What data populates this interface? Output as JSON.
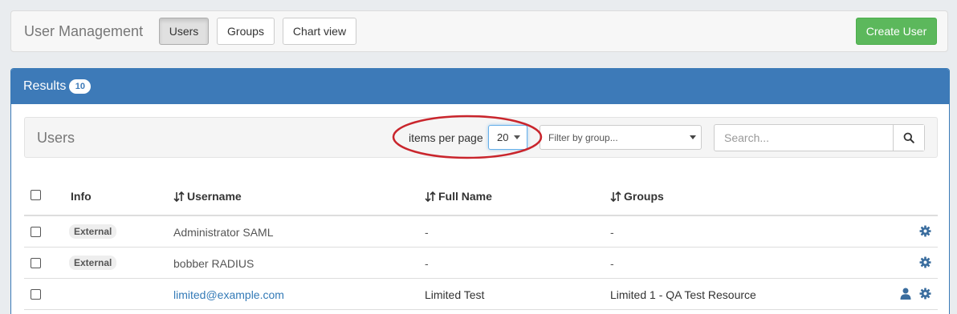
{
  "header": {
    "title": "User Management",
    "tabs": [
      {
        "label": "Users",
        "active": true
      },
      {
        "label": "Groups",
        "active": false
      },
      {
        "label": "Chart view",
        "active": false
      }
    ],
    "create_label": "Create User"
  },
  "results": {
    "title": "Results",
    "count": "10"
  },
  "toolbar": {
    "title": "Users",
    "items_per_page_label": "items per page",
    "items_per_page_value": "20",
    "group_filter_placeholder": "Filter by group...",
    "search_placeholder": "Search..."
  },
  "table": {
    "columns": [
      "Info",
      "Username",
      "Full Name",
      "Groups"
    ],
    "rows": [
      {
        "info": "External",
        "username": "Administrator SAML",
        "full_name": "-",
        "groups": "-",
        "icons": [
          "gear-icon"
        ]
      },
      {
        "info": "External",
        "username": "bobber RADIUS",
        "full_name": "-",
        "groups": "-",
        "icons": [
          "gear-icon"
        ]
      },
      {
        "info": "",
        "username": "limited@example.com",
        "full_name": "Limited Test",
        "groups": "Limited 1 - QA Test Resource",
        "icons": [
          "user-icon",
          "gear-icon"
        ]
      }
    ]
  },
  "colors": {
    "primary": "#3d7ab8",
    "success": "#5cb85c",
    "annotation": "#c9252c",
    "link": "#337ab7"
  }
}
